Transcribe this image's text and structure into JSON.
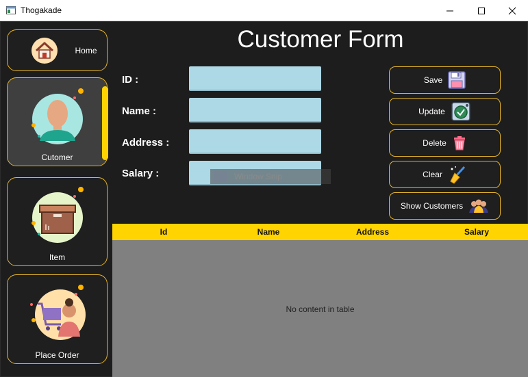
{
  "window": {
    "title": "Thogakade"
  },
  "sidebar": {
    "items": [
      {
        "label": "Home",
        "icon": "home-icon"
      },
      {
        "label": "Cutomer",
        "icon": "customer-avatar-icon",
        "active": true
      },
      {
        "label": "Item",
        "icon": "box-icon"
      },
      {
        "label": "Place Order",
        "icon": "shopping-cart-icon"
      }
    ]
  },
  "form": {
    "title": "Customer Form",
    "fields": [
      {
        "label": "ID :",
        "value": ""
      },
      {
        "label": "Name :",
        "value": ""
      },
      {
        "label": "Address :",
        "value": ""
      },
      {
        "label": "Salary :",
        "value": ""
      }
    ]
  },
  "overlay": {
    "text": "Window Snip"
  },
  "actions": [
    {
      "label": "Save",
      "icon": "floppy-disk-icon"
    },
    {
      "label": "Update",
      "icon": "refresh-icon"
    },
    {
      "label": "Delete",
      "icon": "trash-icon"
    },
    {
      "label": "Clear",
      "icon": "broom-icon"
    },
    {
      "label": "Show Customers",
      "icon": "people-icon"
    }
  ],
  "table": {
    "columns": [
      "Id",
      "Name",
      "Address",
      "Salary"
    ],
    "empty_message": "No content in table"
  },
  "colors": {
    "accent": "#ffd400",
    "border": "#e7b52a",
    "background": "#1d1d1d",
    "input": "#add8e6",
    "table_body": "#808080"
  }
}
